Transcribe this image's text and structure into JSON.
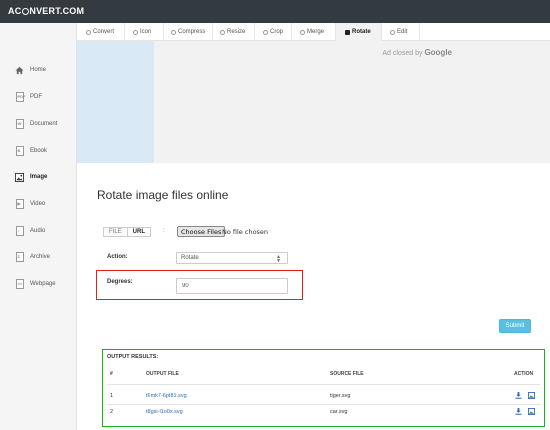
{
  "brand": {
    "logo_pre": "AC",
    "logo_post": "NVERT.COM"
  },
  "sidebar": {
    "items": [
      {
        "label": "Home",
        "icon": "home-icon"
      },
      {
        "label": "PDF",
        "icon": "pdf-file-icon"
      },
      {
        "label": "Document",
        "icon": "document-file-icon"
      },
      {
        "label": "Ebook",
        "icon": "ebook-icon"
      },
      {
        "label": "Image",
        "icon": "image-icon",
        "active": true
      },
      {
        "label": "Video",
        "icon": "video-icon"
      },
      {
        "label": "Audio",
        "icon": "audio-icon"
      },
      {
        "label": "Archive",
        "icon": "archive-icon"
      },
      {
        "label": "Webpage",
        "icon": "webpage-icon"
      }
    ]
  },
  "tabs": [
    {
      "label": "Convert"
    },
    {
      "label": "Icon"
    },
    {
      "label": "Compress"
    },
    {
      "label": "Resize"
    },
    {
      "label": "Crop"
    },
    {
      "label": "Merge"
    },
    {
      "label": "Rotate",
      "active": true
    },
    {
      "label": "Edit"
    }
  ],
  "ad": {
    "closed_text": "Ad closed by",
    "brand": "Google"
  },
  "page": {
    "title": "Rotate image files online"
  },
  "form": {
    "source_file": "FILE",
    "source_url": "URL",
    "separator": ":",
    "choose_button": "Choose Files",
    "no_file_text": "No file chosen",
    "action_label": "Action:",
    "action_value": "Rotate",
    "degrees_label": "Degrees:",
    "degrees_value": "90",
    "submit_label": "Submit"
  },
  "output": {
    "title": "OUTPUT RESULTS:",
    "headers": {
      "num": "#",
      "output_file": "OUTPUT FILE",
      "source_file": "SOURCE FILE",
      "action": "ACTION"
    },
    "rows": [
      {
        "num": "1",
        "output_file": "t6mk7-6pt81.svg",
        "source_file": "tiger.svg"
      },
      {
        "num": "2",
        "output_file": "t8gsi-l1o0x.svg",
        "source_file": "car.svg"
      }
    ]
  },
  "colors": {
    "topbar": "#333a40",
    "submit": "#5bc0de",
    "link": "#2a6fb0",
    "degrees_highlight": "#dd2222",
    "output_highlight": "#22aa22"
  }
}
